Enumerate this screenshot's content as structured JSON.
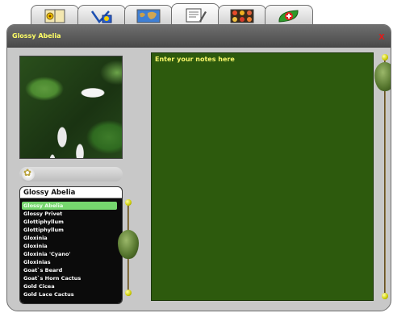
{
  "tabs": [
    {
      "icon": "flower-book-icon",
      "active": false
    },
    {
      "icon": "sun-calendar-icon",
      "active": false
    },
    {
      "icon": "map-icon",
      "active": false
    },
    {
      "icon": "notepad-pencil-icon",
      "active": true
    },
    {
      "icon": "plant-grid-icon",
      "active": false
    },
    {
      "icon": "leaf-first-aid-icon",
      "active": false
    }
  ],
  "window": {
    "title": "Glossy Abelia",
    "close_label": "x"
  },
  "list": {
    "header": "Glossy Abelia",
    "selected_index": 0,
    "items": [
      "Glossy Abelia",
      "Glossy Privet",
      "Glottiphyllum",
      "Glottiphyllum",
      "Gloxinia",
      "Gloxinia",
      "Gloxinia 'Cyano'",
      "Gloxinias",
      "Goat`s Beard",
      "Goat`s Horn Cactus",
      "Gold Cicea",
      "Gold Lace Cactus"
    ]
  },
  "notes": {
    "placeholder": "Enter your notes here",
    "value": ""
  },
  "colors": {
    "notes_bg": "#2d5a0d",
    "accent_text": "#f8f86a",
    "selection": "#76d76e",
    "close": "#e21a1a"
  }
}
